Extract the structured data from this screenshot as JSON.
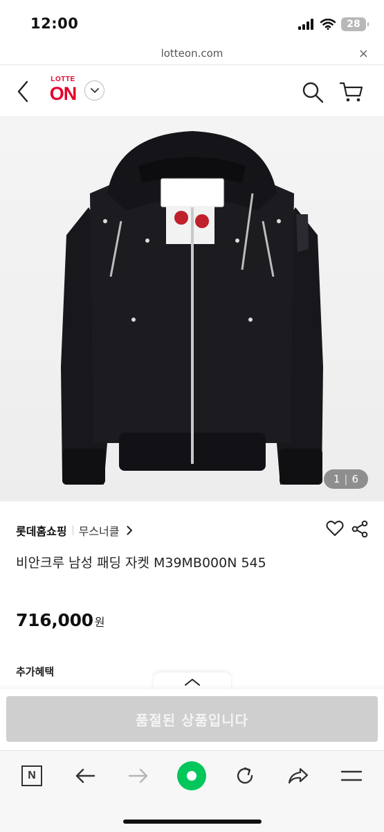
{
  "status_bar": {
    "time": "12:00",
    "battery": "28"
  },
  "browser": {
    "url": "lotteon.com",
    "close_label": "×"
  },
  "header": {
    "logo_top": "LOTTE",
    "logo_main": "ON"
  },
  "gallery": {
    "current": "1",
    "separator": "|",
    "total": "6"
  },
  "product": {
    "seller": "롯데홈쇼핑",
    "brand": "무스너클",
    "title": "비안크루 남성 패딩 자켓 M39MB000N 545",
    "price": "716,000",
    "currency": "원",
    "benefits_label": "추가혜택",
    "soldout_label": "품절된 상품입니다"
  },
  "colors": {
    "brand_red": "#e4002b",
    "naver_green": "#03c75a",
    "soldout_gray": "#cfcfcf"
  }
}
